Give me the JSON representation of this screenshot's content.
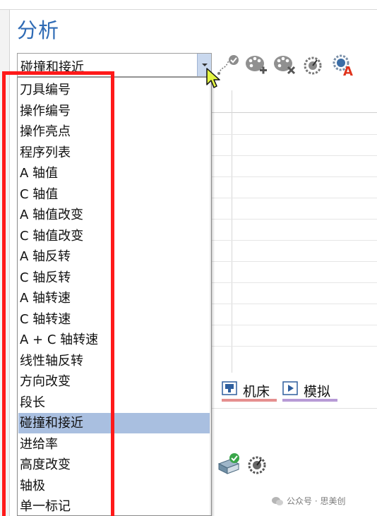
{
  "panel": {
    "title": "分析"
  },
  "combo": {
    "value": "碰撞和接近"
  },
  "toolbar": {
    "icons": [
      "path-check-icon",
      "palette-add-icon",
      "palette-remove-icon",
      "gauge-dial-icon",
      "color-letter-a-icon"
    ]
  },
  "dropdown": {
    "items": [
      "刀具编号",
      "操作编号",
      "操作亮点",
      "程序列表",
      "A 轴值",
      "C 轴值",
      "A 轴值改变",
      "C 轴值改变",
      "A 轴反转",
      "C 轴反转",
      "A 轴转速",
      "C 轴转速",
      "A + C 轴转速",
      "线性轴反转",
      "方向改变",
      "段长",
      "碰撞和接近",
      "进给率",
      "高度改变",
      "轴极",
      "单一标记"
    ],
    "selected_index": 16
  },
  "tabs": [
    {
      "label": "机床",
      "icon": "machine-tool-icon",
      "underline_color": "#e58f8f"
    },
    {
      "label": "模拟",
      "icon": "play-simulation-icon",
      "underline_color": "#b79ad6"
    }
  ],
  "annotation": {
    "color": "#ff1a1a"
  },
  "watermark": {
    "text": "公众号 · 思美创"
  }
}
